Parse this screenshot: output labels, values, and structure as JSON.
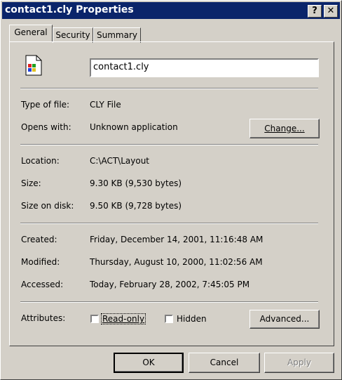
{
  "window": {
    "title": "contact1.cly Properties",
    "help_button": "?",
    "close_button": "✕"
  },
  "tabs": [
    {
      "label": "General"
    },
    {
      "label": "Security"
    },
    {
      "label": "Summary"
    }
  ],
  "general": {
    "file_name": "contact1.cly",
    "type_label": "Type of file:",
    "type_value": "CLY File",
    "opens_label": "Opens with:",
    "opens_value": "Unknown application",
    "change_button": "Change...",
    "location_label": "Location:",
    "location_value": "C:\\ACT\\Layout",
    "size_label": "Size:",
    "size_value": "9.30 KB (9,530 bytes)",
    "size_disk_label": "Size on disk:",
    "size_disk_value": "9.50 KB (9,728 bytes)",
    "created_label": "Created:",
    "created_value": "Friday, December 14, 2001, 11:16:48 AM",
    "modified_label": "Modified:",
    "modified_value": "Thursday, August 10, 2000, 11:02:56 AM",
    "accessed_label": "Accessed:",
    "accessed_value": "Today, February 28, 2002, 7:45:05 PM",
    "attributes_label": "Attributes:",
    "readonly_label": "Read-only",
    "readonly_checked": false,
    "hidden_label": "Hidden",
    "hidden_checked": false,
    "advanced_button": "Advanced..."
  },
  "footer": {
    "ok_button": "OK",
    "cancel_button": "Cancel",
    "apply_button": "Apply"
  },
  "icons": {
    "file_icon": "windows-file-icon"
  }
}
